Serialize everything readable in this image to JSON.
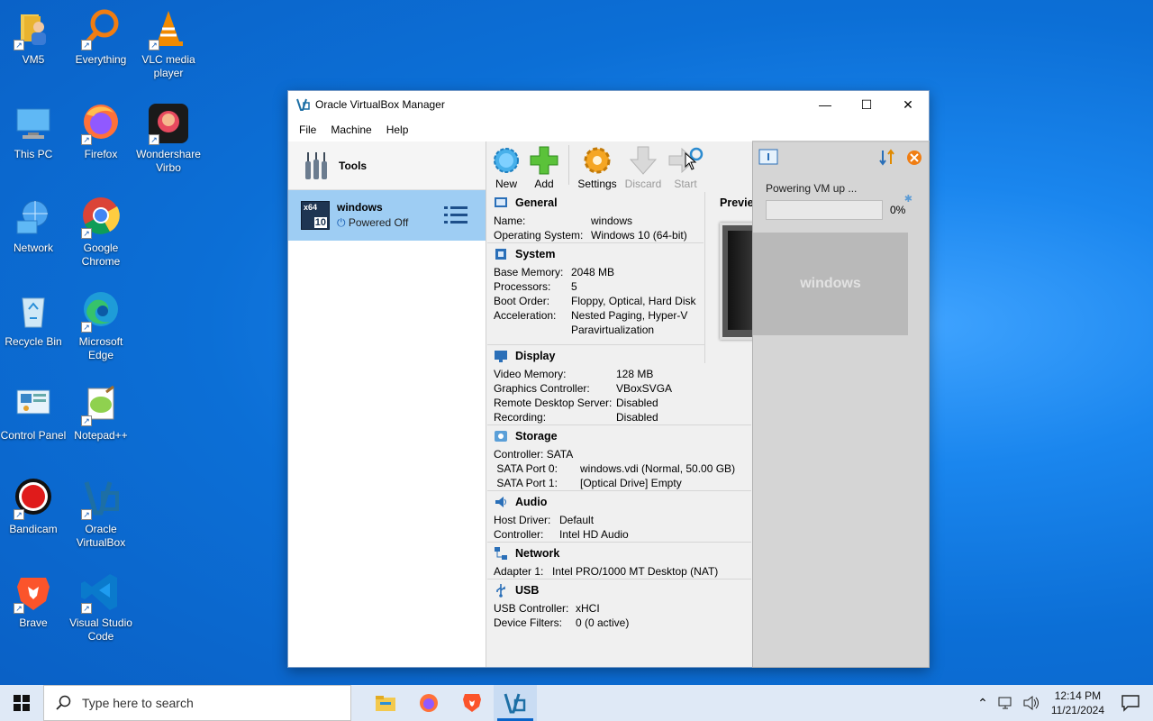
{
  "desktop": {
    "icons": [
      {
        "label": "VM5"
      },
      {
        "label": "Everything"
      },
      {
        "label": "VLC media player"
      },
      {
        "label": "This PC"
      },
      {
        "label": "Firefox"
      },
      {
        "label": "Wondershare Virbo"
      },
      {
        "label": "Network"
      },
      {
        "label": "Google Chrome"
      },
      {
        "label": "Recycle Bin"
      },
      {
        "label": "Microsoft Edge"
      },
      {
        "label": "Control Panel"
      },
      {
        "label": "Notepad++"
      },
      {
        "label": "Bandicam"
      },
      {
        "label": "Oracle VirtualBox"
      },
      {
        "label": "Brave"
      },
      {
        "label": "Visual Studio Code"
      }
    ]
  },
  "window": {
    "title": "Oracle VirtualBox Manager",
    "minimize": "—",
    "maximize": "☐",
    "close": "✕",
    "menu": [
      "File",
      "Machine",
      "Help"
    ]
  },
  "sidebar": {
    "tools_label": "Tools",
    "vm": {
      "name": "windows",
      "state": "Powered Off",
      "badge_top": "x64",
      "badge_bottom": "10"
    }
  },
  "toolbar": {
    "new": "New",
    "add": "Add",
    "settings": "Settings",
    "discard": "Discard",
    "start": "Start"
  },
  "details": {
    "general": {
      "title": "General",
      "rows": [
        [
          "Name:",
          "windows"
        ],
        [
          "Operating System:",
          "Windows 10 (64-bit)"
        ]
      ]
    },
    "system": {
      "title": "System",
      "rows": [
        [
          "Base Memory:",
          "2048 MB"
        ],
        [
          "Processors:",
          "5"
        ],
        [
          "Boot Order:",
          "Floppy, Optical, Hard Disk"
        ],
        [
          "Acceleration:",
          "Nested Paging, Hyper-V"
        ],
        [
          "",
          "Paravirtualization"
        ]
      ]
    },
    "display": {
      "title": "Display",
      "rows": [
        [
          "Video Memory:",
          "128 MB"
        ],
        [
          "Graphics Controller:",
          "VBoxSVGA"
        ],
        [
          "Remote Desktop Server:",
          "Disabled"
        ],
        [
          "Recording:",
          "Disabled"
        ]
      ]
    },
    "storage": {
      "title": "Storage",
      "rows": [
        [
          "Controller: SATA",
          ""
        ],
        [
          " SATA Port 0:",
          "windows.vdi (Normal, 50.00 GB)"
        ],
        [
          " SATA Port 1:",
          "[Optical Drive] Empty"
        ]
      ]
    },
    "audio": {
      "title": "Audio",
      "rows": [
        [
          "Host Driver:",
          "Default"
        ],
        [
          "Controller:",
          "Intel HD Audio"
        ]
      ]
    },
    "network": {
      "title": "Network",
      "rows": [
        [
          "Adapter 1:",
          "Intel PRO/1000 MT Desktop (NAT)"
        ]
      ]
    },
    "usb": {
      "title": "USB",
      "rows": [
        [
          "USB Controller:",
          "xHCI"
        ],
        [
          "Device Filters:",
          "0 (0 active)"
        ]
      ]
    },
    "preview_title": "Preview",
    "preview_text": "windows"
  },
  "popup": {
    "message": "Powering VM up ...",
    "progress_fraction": 0.0,
    "progress_text": "0%"
  },
  "taskbar": {
    "search_placeholder": "Type here to search",
    "time": "12:14 PM",
    "date": "11/21/2024"
  }
}
